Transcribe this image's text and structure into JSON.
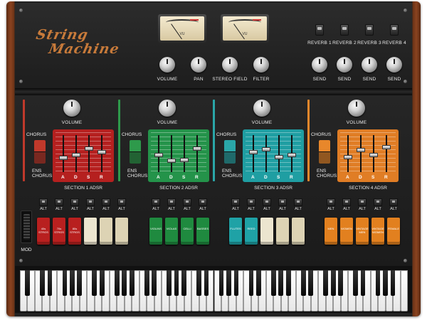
{
  "logo": {
    "line1": "String",
    "line2": "Machine"
  },
  "meters": [
    {
      "label": "VU"
    },
    {
      "label": "VU"
    }
  ],
  "master_knobs": [
    "VOLUME",
    "PAN",
    "STEREO FIELD",
    "FILTER"
  ],
  "reverb_buttons": [
    "REVERB 1",
    "REVERB 2",
    "REVERB 3",
    "REVERB 4"
  ],
  "send_knobs": [
    "SEND",
    "SEND",
    "SEND",
    "SEND"
  ],
  "sections": [
    {
      "volume_label": "VOLUME",
      "chorus_label": "CHORUS",
      "ens_label_1": "ENS",
      "ens_label_2": "CHORUS",
      "adsr_letters": [
        "A",
        "D",
        "S",
        "R"
      ],
      "title": "SECTION 1 ADSR",
      "color": "#c0392b",
      "adsr_color": "#b5201f"
    },
    {
      "volume_label": "VOLUME",
      "chorus_label": "CHORUS",
      "ens_label_1": "ENS",
      "ens_label_2": "CHORUS",
      "adsr_letters": [
        "A",
        "D",
        "S",
        "R"
      ],
      "title": "SECTION 2 ADSR",
      "color": "#2e9a4b",
      "adsr_color": "#24934a"
    },
    {
      "volume_label": "VOLUME",
      "chorus_label": "CHORUS",
      "ens_label_1": "ENS",
      "ens_label_2": "CHORUS",
      "adsr_letters": [
        "A",
        "D",
        "S",
        "R"
      ],
      "title": "SECTION 3 ADSR",
      "color": "#2aa6a8",
      "adsr_color": "#1f9ea2"
    },
    {
      "volume_label": "VOLUME",
      "chorus_label": "CHORUS",
      "ens_label_1": "ENS",
      "ens_label_2": "CHORUS",
      "adsr_letters": [
        "A",
        "D",
        "S",
        "R"
      ],
      "title": "SECTION 4 ADSR",
      "color": "#e8872b",
      "adsr_color": "#e07d25"
    }
  ],
  "alt_label": "ALT",
  "tab_groups": [
    {
      "tabs": [
        {
          "label": "40s STRGS",
          "color": "#b8201f"
        },
        {
          "label": "70s STRGS",
          "color": "#b8201f"
        },
        {
          "label": "80s STRGS",
          "color": "#b8201f"
        },
        {
          "label": "",
          "color": "#ece5cf"
        },
        {
          "label": "",
          "color": "#ddd3b4"
        },
        {
          "label": "",
          "color": "#ddd3b4"
        }
      ]
    },
    {
      "tabs": [
        {
          "label": "VIOLINS",
          "color": "#1f8a3f"
        },
        {
          "label": "VIOLAS",
          "color": "#1f8a3f"
        },
        {
          "label": "CELLI",
          "color": "#1f8a3f"
        },
        {
          "label": "BASSES",
          "color": "#1f8a3f"
        }
      ]
    },
    {
      "tabs": [
        {
          "label": "FLUTES",
          "color": "#1fa2a6"
        },
        {
          "label": "REED",
          "color": "#1fa2a6"
        },
        {
          "label": "",
          "color": "#ece5cf"
        },
        {
          "label": "",
          "color": "#ddd3b4"
        },
        {
          "label": "",
          "color": "#ddd3b4"
        }
      ]
    },
    {
      "tabs": [
        {
          "label": "MEN",
          "color": "#e2801f"
        },
        {
          "label": "WOMEN",
          "color": "#e2801f"
        },
        {
          "label": "VINTAGE MEN",
          "color": "#e2801f"
        },
        {
          "label": "VINTAGE WOMEN",
          "color": "#e2801f"
        },
        {
          "label": "FEMALE",
          "color": "#e2801f"
        }
      ]
    }
  ],
  "mod_label": "MOD"
}
